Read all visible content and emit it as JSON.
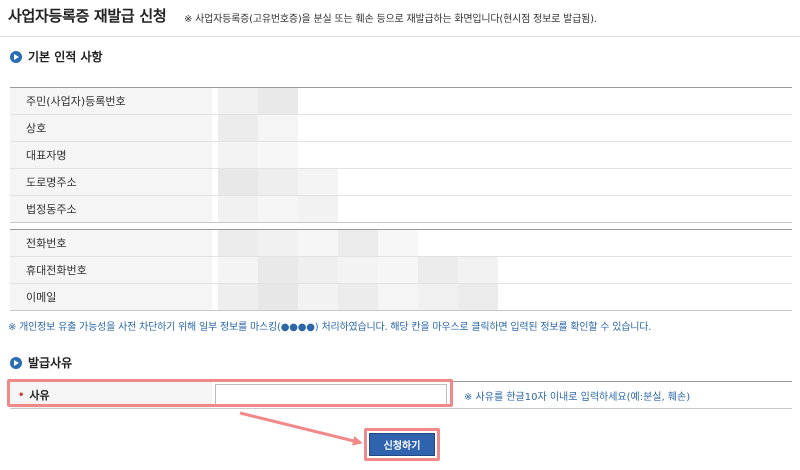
{
  "header": {
    "title": "사업자등록증 재발급 신청",
    "note": "※ 사업자등록증(고유번호증)을 분실 또는 훼손 등으로 재발급하는 화면입니다(현시점 정보로 발급됨)."
  },
  "basic_section": {
    "title": "기본 인적 사항",
    "group1": [
      {
        "label": "주민(사업자)등록번호"
      },
      {
        "label": "상호"
      },
      {
        "label": "대표자명"
      },
      {
        "label": "도로명주소"
      },
      {
        "label": "법정동주소"
      }
    ],
    "group2": [
      {
        "label": "전화번호"
      },
      {
        "label": "휴대전화번호"
      },
      {
        "label": "이메일"
      }
    ]
  },
  "mask_note": "※ 개인정보 유출 가능성을 사전 차단하기 위해 일부 정보를 마스킹(●●●●) 처리하였습니다. 해당 칸을 마우스로 클릭하면 입력된 정보를 확인할 수 있습니다.",
  "reason_section": {
    "title": "발급사유",
    "label": "사유",
    "required_mark": "•",
    "input_value": "",
    "hint": "※ 사유를 한글10자 이내로 입력하세요(예:분실, 훼손)"
  },
  "submit": {
    "label": "신청하기"
  },
  "colors": {
    "accent": "#2f63ad",
    "highlight": "#f08a8a",
    "note_blue": "#2b67a8"
  }
}
